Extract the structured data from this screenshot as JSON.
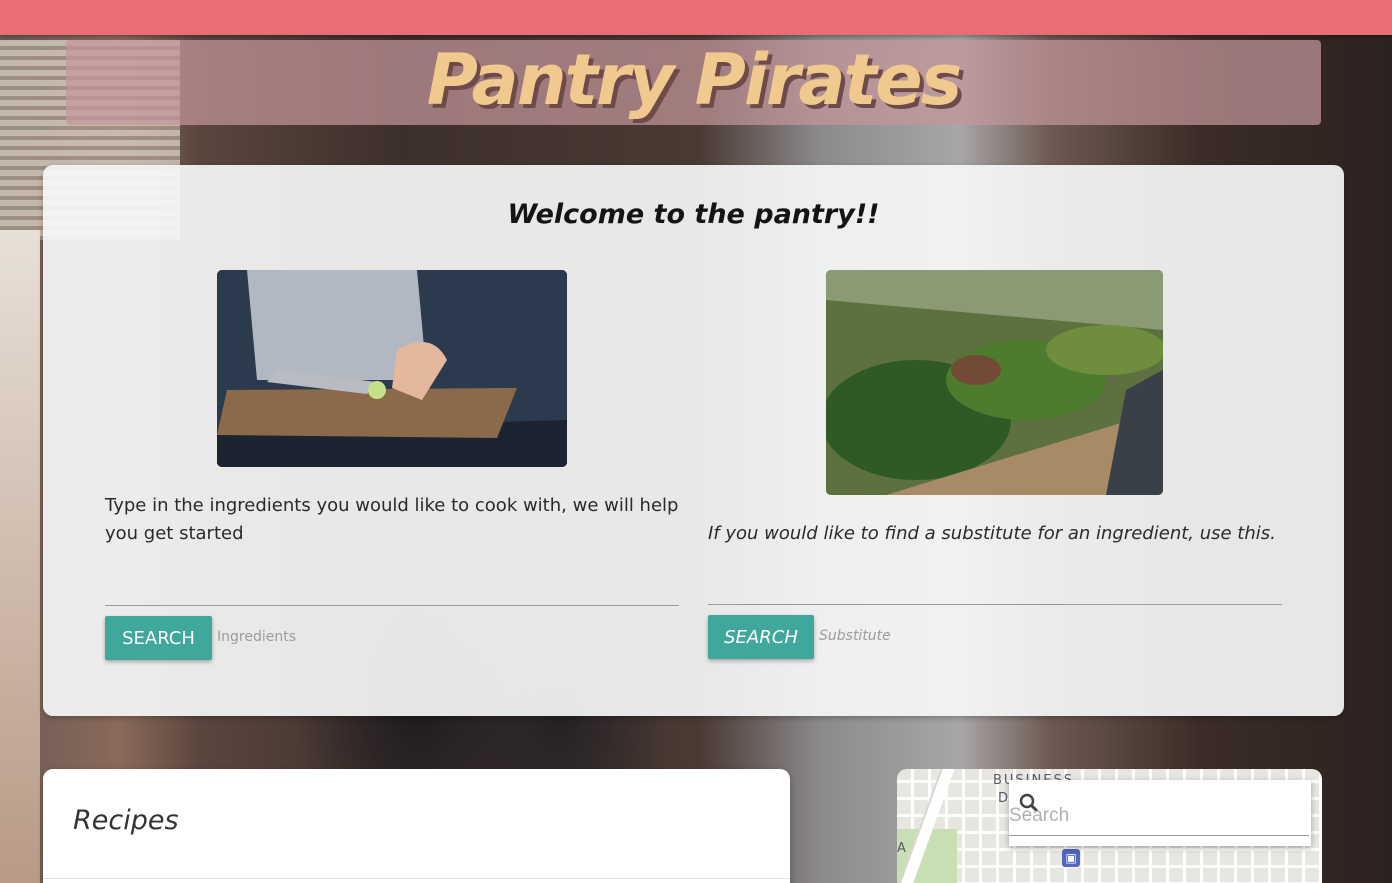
{
  "header": {
    "site_title": "Pantry Pirates"
  },
  "welcome": {
    "heading": "Welcome to the pantry!!",
    "ingredients_description": "Type in the ingredients you would like to cook with, we will help you get started",
    "ingredients_button": "SEARCH",
    "ingredients_label": "Ingredients",
    "substitute_description": "If you would like to find a substitute for an ingredient, use this.",
    "substitute_button": "SEARCH",
    "substitute_label": "Substitute"
  },
  "recipes": {
    "heading": "Recipes"
  },
  "map": {
    "search_placeholder": "Search",
    "labels": {
      "business": "BUSINESS",
      "d": "D",
      "a": "A"
    }
  },
  "colors": {
    "topbar": "#e96d75",
    "title_text": "#f0c98e",
    "button": "#3fa89a"
  }
}
